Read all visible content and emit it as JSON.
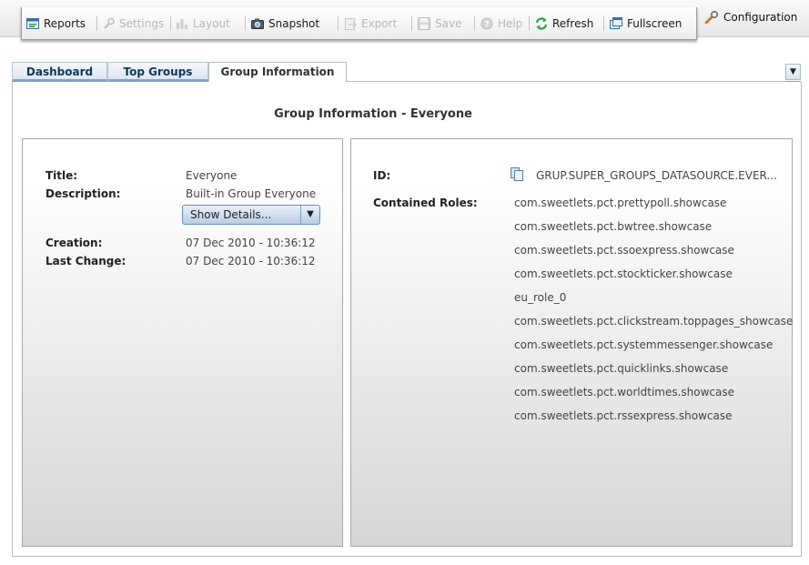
{
  "toolbar": {
    "reports": "Reports",
    "settings": "Settings",
    "layout": "Layout",
    "snapshot": "Snapshot",
    "export": "Export",
    "save": "Save",
    "help": "Help",
    "refresh": "Refresh",
    "fullscreen": "Fullscreen"
  },
  "configuration": "Configuration",
  "tabs": {
    "dashboard": "Dashboard",
    "top_groups": "Top Groups",
    "group_information": "Group Information"
  },
  "page_title": "Group Information - Everyone",
  "group": {
    "title_label": "Title:",
    "title_value": "Everyone",
    "description_label": "Description:",
    "description_value": "Built-in Group Everyone",
    "show_details": "Show Details...",
    "creation_label": "Creation:",
    "creation_value": "07 Dec 2010 - 10:36:12",
    "last_change_label": "Last Change:",
    "last_change_value": "07 Dec 2010 - 10:36:12"
  },
  "detail": {
    "id_label": "ID:",
    "id_value": "GRUP.SUPER_GROUPS_DATASOURCE.EVER...",
    "roles_label": "Contained Roles:",
    "roles": [
      "com.sweetlets.pct.prettypoll.showcase",
      "com.sweetlets.pct.bwtree.showcase",
      "com.sweetlets.pct.ssoexpress.showcase",
      "com.sweetlets.pct.stockticker.showcase",
      "eu_role_0",
      "com.sweetlets.pct.clickstream.toppages_showcase",
      "com.sweetlets.pct.systemmessenger.showcase",
      "com.sweetlets.pct.quicklinks.showcase",
      "com.sweetlets.pct.worldtimes.showcase",
      "com.sweetlets.pct.rssexpress.showcase"
    ]
  },
  "colors": {
    "tab_text": "#12355c",
    "tab_underline": "#7fa3c9",
    "button_border": "#6b8fb8"
  }
}
